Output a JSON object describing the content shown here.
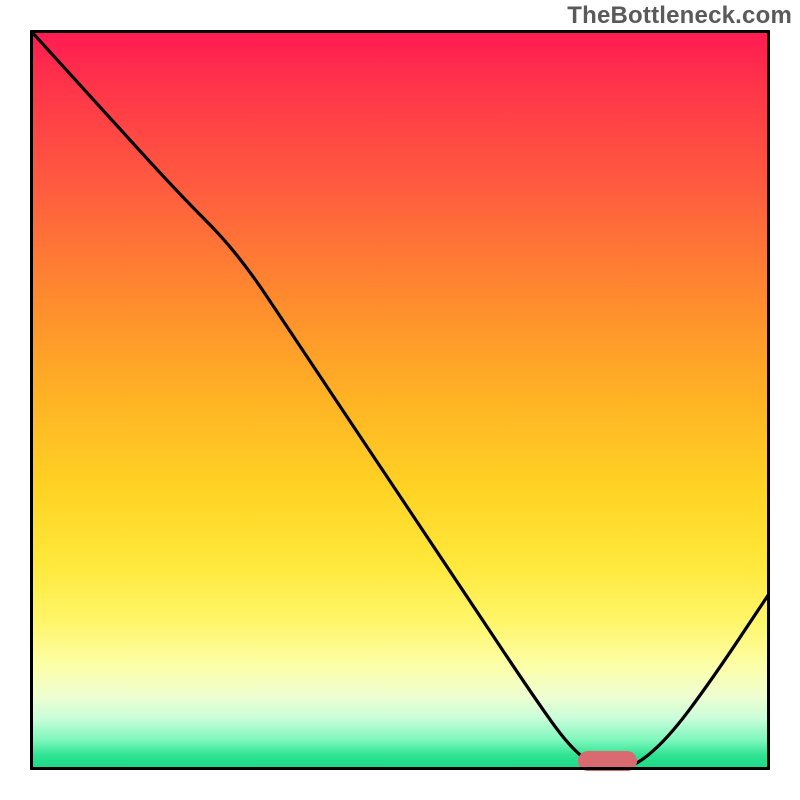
{
  "watermark": "TheBottleneck.com",
  "chart_data": {
    "type": "line",
    "title": "",
    "xlabel": "",
    "ylabel": "",
    "xlim": [
      0,
      100
    ],
    "ylim": [
      0,
      100
    ],
    "grid": false,
    "legend": false,
    "background_gradient": {
      "direction": "vertical",
      "stops": [
        {
          "pos": 0,
          "color": "#ff1a52"
        },
        {
          "pos": 50,
          "color": "#ffd324"
        },
        {
          "pos": 85,
          "color": "#fcffa9"
        },
        {
          "pos": 100,
          "color": "#17d985"
        }
      ]
    },
    "series": [
      {
        "name": "bottleneck-curve",
        "color": "#000000",
        "x": [
          0,
          10,
          20,
          28,
          36,
          44,
          52,
          60,
          68,
          73,
          77,
          81,
          86,
          92,
          100
        ],
        "y": [
          100,
          89,
          78,
          70,
          58,
          46,
          34,
          22,
          10,
          3,
          0,
          0,
          4,
          12,
          24
        ]
      }
    ],
    "marker": {
      "name": "optimal-range",
      "color": "#d96a6f",
      "x_start": 74,
      "x_end": 82,
      "y": 1
    }
  }
}
